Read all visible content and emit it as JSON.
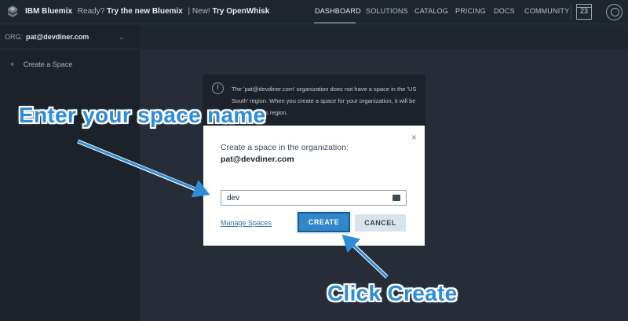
{
  "topbar": {
    "brand": "IBM Bluemix",
    "announcement_muted": "Ready?",
    "announcement_link": "Try the new Bluemix",
    "announcement_sep": "| New!",
    "announcement_link2": "Try OpenWhisk",
    "nav": [
      {
        "label": "DASHBOARD",
        "active": true
      },
      {
        "label": "SOLUTIONS"
      },
      {
        "label": "CATALOG"
      },
      {
        "label": "PRICING"
      },
      {
        "label": "DOCS"
      },
      {
        "label": "COMMUNITY"
      }
    ],
    "calendar_day": "23"
  },
  "sidebar": {
    "org_label": "ORG:",
    "org_value": "pat@devdiner.com",
    "create_space_plus": "+",
    "create_space_label": "Create a Space"
  },
  "notice": {
    "icon": "info-icon",
    "text": "The 'pat@devdiner.com' organization does not have a space in the 'US South' region. When you create a space for your organization, it will be created in this region."
  },
  "dialog": {
    "close": "×",
    "subtitle": "Create a space in the organization:",
    "org_email": "pat@devdiner.com",
    "input_value": "dev",
    "manage_link": "Manage Spaces",
    "create_label": "CREATE",
    "cancel_label": "CANCEL"
  },
  "annotations": {
    "enter_text": "Enter your space name",
    "click_text": "Click Create",
    "color": "#2f8cd6"
  }
}
